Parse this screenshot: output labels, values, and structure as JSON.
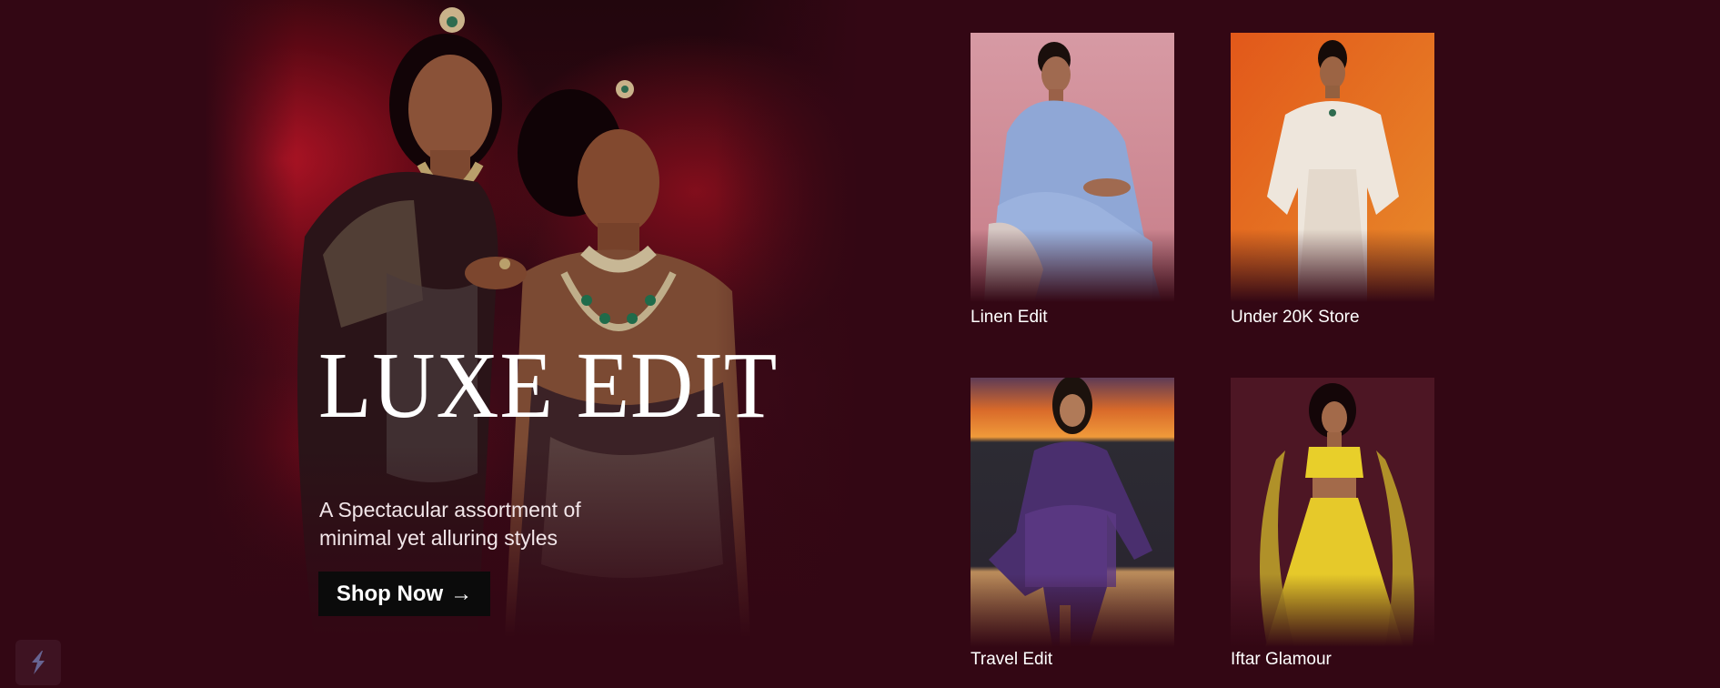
{
  "hero": {
    "title": "LUXE EDIT",
    "subtitle": "A Spectacular assortment of minimal yet alluring styles",
    "cta_label": "Shop Now",
    "cta_icon": "arrow-right-icon"
  },
  "tiles": [
    {
      "label": "Linen Edit"
    },
    {
      "label": "Under 20K Store"
    },
    {
      "label": "Travel Edit"
    },
    {
      "label": "Iftar Glamour"
    }
  ],
  "badge": {
    "icon": "bolt-logo-icon"
  },
  "colors": {
    "background": "#330714",
    "button": "#0b0b0b",
    "text": "#ffffff"
  }
}
